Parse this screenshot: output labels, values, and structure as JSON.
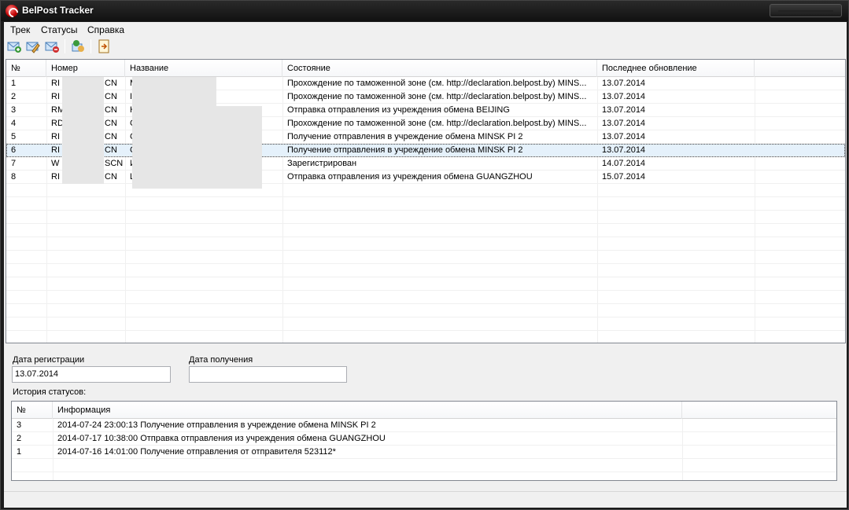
{
  "window": {
    "title": "BelPost Tracker"
  },
  "menu": {
    "items": [
      "Трек",
      "Статусы",
      "Справка"
    ]
  },
  "toolbar": {
    "icons": [
      "add-track-icon",
      "edit-track-icon",
      "delete-track-icon",
      "refresh-statuses-icon",
      "export-icon"
    ]
  },
  "tracks": {
    "columns": [
      "№",
      "Номер",
      "Название",
      "Состояние",
      "Последнее обновление"
    ],
    "rows": [
      {
        "n": "1",
        "num_a": "RI",
        "num_b": "CN",
        "name": "M",
        "state": "Прохождение по таможенной зоне (см. http://declaration.belpost.by) MINS...",
        "updated": "13.07.2014"
      },
      {
        "n": "2",
        "num_a": "RI",
        "num_b": "CN",
        "name": "I",
        "state": "Прохождение по таможенной зоне (см. http://declaration.belpost.by) MINS...",
        "updated": "13.07.2014"
      },
      {
        "n": "3",
        "num_a": "RM",
        "num_b": "CN",
        "name": "H",
        "state": "Отправка отправления из учреждения обмена BEIJING",
        "updated": "13.07.2014"
      },
      {
        "n": "4",
        "num_a": "RD",
        "num_b": "CN",
        "name": "C",
        "state": "Прохождение по таможенной зоне (см. http://declaration.belpost.by) MINS...",
        "updated": "13.07.2014"
      },
      {
        "n": "5",
        "num_a": "RI",
        "num_b": "CN",
        "name": "C",
        "state": "Получение отправления в учреждение обмена MINSK PI 2",
        "updated": "13.07.2014"
      },
      {
        "n": "6",
        "num_a": "RI",
        "num_b": "CN",
        "name": "C",
        "state": "Получение отправления в учреждение обмена MINSK PI 2",
        "updated": "13.07.2014"
      },
      {
        "n": "7",
        "num_a": "W",
        "num_b": "SCN",
        "name": "И",
        "state": "Зарегистрирован",
        "updated": "14.07.2014"
      },
      {
        "n": "8",
        "num_a": "RI",
        "num_b": "CN",
        "name": "L",
        "state": "Отправка отправления из учреждения обмена GUANGZHOU",
        "updated": "15.07.2014"
      }
    ]
  },
  "details": {
    "reg_label": "Дата регистрации",
    "reg_value": "13.07.2014",
    "recv_label": "Дата получения",
    "recv_value": "",
    "history_label": "История статусов:"
  },
  "history": {
    "columns": [
      "№",
      "Информация"
    ],
    "rows": [
      {
        "n": "3",
        "info": "2014-07-24 23:00:13 Получение отправления в учреждение обмена MINSK PI 2"
      },
      {
        "n": "2",
        "info": "2014-07-17 10:38:00 Отправка отправления из учреждения обмена GUANGZHOU"
      },
      {
        "n": "1",
        "info": "2014-07-16 14:01:00 Получение отправления от отправителя 523112*"
      }
    ]
  },
  "colors": {
    "selection": "#e5f1fb",
    "border": "#828790"
  }
}
